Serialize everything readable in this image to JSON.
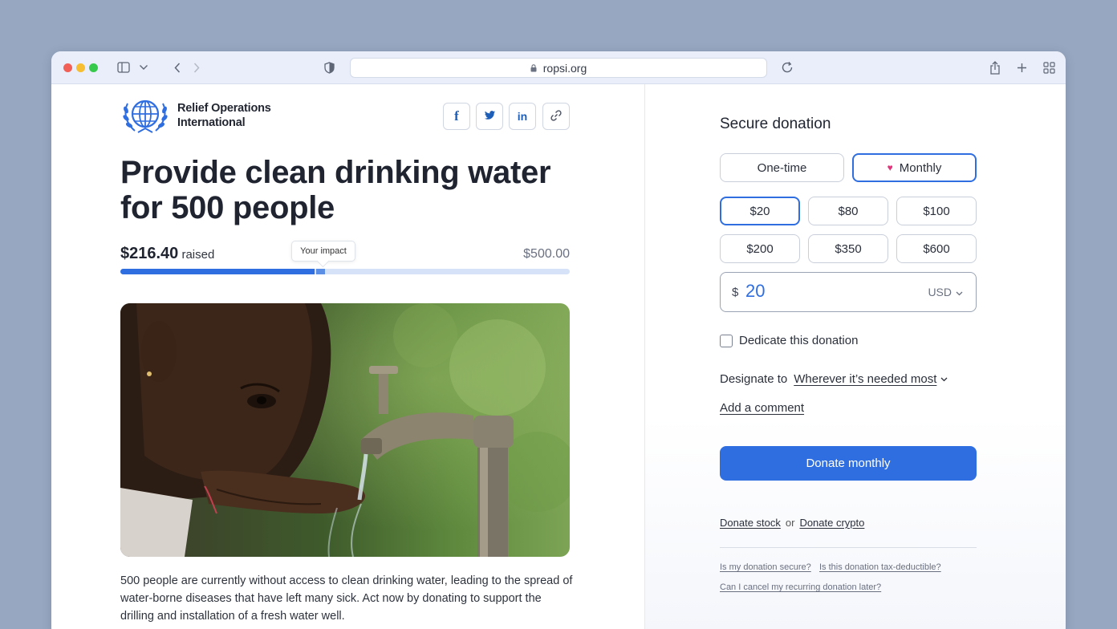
{
  "browser": {
    "url": "ropsi.org"
  },
  "organization": {
    "name_line1": "Relief Operations",
    "name_line2": "International"
  },
  "share": {
    "facebook": "f",
    "twitter_icon": "twitter-icon",
    "linkedin": "in",
    "link_icon": "link-icon"
  },
  "campaign": {
    "title": "Provide clean drinking water for 500 people",
    "raised_amount": "$216.40",
    "raised_label": "raised",
    "goal": "$500.00",
    "tooltip": "Your impact",
    "progress_fraction": 0.4328,
    "impact_fraction": 0.04,
    "description": "500 people are currently without access to clean drinking water, leading to the spread of water-borne diseases that have left many sick. Act now by donating to support the drilling and installation of a fresh water well."
  },
  "donation": {
    "title": "Secure donation",
    "frequency": {
      "one_time": "One-time",
      "monthly": "Monthly",
      "selected": "monthly"
    },
    "amounts": [
      "$20",
      "$80",
      "$100",
      "$200",
      "$350",
      "$600"
    ],
    "selected_amount": "$20",
    "currency_symbol": "$",
    "amount_value": "20",
    "currency": "USD",
    "dedicate_label": "Dedicate this donation",
    "designate_label": "Designate to",
    "designate_value": "Wherever it’s needed most",
    "comment_link": "Add a comment",
    "donate_button": "Donate monthly",
    "donate_stock": "Donate stock",
    "or": "or",
    "donate_crypto": "Donate crypto",
    "faq": [
      "Is my donation secure?",
      "Is this donation tax-deductible?",
      "Can I cancel my recurring donation later?"
    ]
  },
  "colors": {
    "accent": "#2f6ee0",
    "page_background": "#97a7c1",
    "heart": "#e0347a"
  }
}
